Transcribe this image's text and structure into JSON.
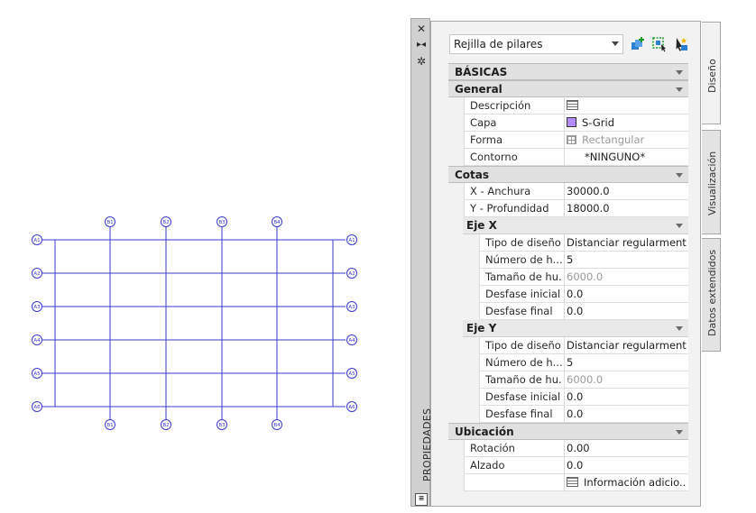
{
  "drawing": {
    "line_color": "#3a3ad0",
    "rows_left": [
      "A1",
      "A2",
      "A3",
      "A4",
      "A5",
      "A6"
    ],
    "rows_right": [
      "A1",
      "A2",
      "A3",
      "A4",
      "A5",
      "A6"
    ],
    "cols_top": [
      "B1",
      "B2",
      "B3",
      "B4"
    ],
    "cols_bottom": [
      "B1",
      "B2",
      "B3",
      "B4"
    ]
  },
  "palette": {
    "title": "PROPIEDADES",
    "style_select": {
      "value": "Rejilla de pilares"
    },
    "tabs": [
      "Diseño",
      "Visualización",
      "Datos extendidos"
    ],
    "basicas": "BÁSICAS",
    "general": {
      "title": "General",
      "rows": [
        {
          "name": "Descripción",
          "value": "",
          "icon": "description-icon"
        },
        {
          "name": "Capa",
          "value": "S-Grid",
          "icon": "layer-swatch",
          "swatch_color": "#b58cff"
        },
        {
          "name": "Forma",
          "value": "Rectangular",
          "icon": "grid-shape-icon",
          "disabled": true
        },
        {
          "name": "Contorno",
          "value": "*NINGUNO*"
        }
      ]
    },
    "cotas": {
      "title": "Cotas",
      "rows": [
        {
          "name": "X - Anchura",
          "value": "30000.0"
        },
        {
          "name": "Y - Profundidad",
          "value": "18000.0"
        }
      ],
      "eje_x": {
        "title": "Eje X",
        "rows": [
          {
            "name": "Tipo de diseño",
            "value": "Distanciar regularmente"
          },
          {
            "name": "Número de h...",
            "value": "5"
          },
          {
            "name": "Tamaño de hu...",
            "value": "6000.0",
            "disabled": true
          },
          {
            "name": "Desfase inicial",
            "value": "0.0"
          },
          {
            "name": "Desfase final",
            "value": "0.0"
          }
        ]
      },
      "eje_y": {
        "title": "Eje Y",
        "rows": [
          {
            "name": "Tipo de diseño",
            "value": "Distanciar regularmente"
          },
          {
            "name": "Número de h...",
            "value": "5"
          },
          {
            "name": "Tamaño de hu...",
            "value": "6000.0",
            "disabled": true
          },
          {
            "name": "Desfase inicial",
            "value": "0.0"
          },
          {
            "name": "Desfase final",
            "value": "0.0"
          }
        ]
      }
    },
    "ubicacion": {
      "title": "Ubicación",
      "rows": [
        {
          "name": "Rotación",
          "value": "0.00"
        },
        {
          "name": "Alzado",
          "value": "0.0"
        },
        {
          "name": "",
          "value": "Información adicio...",
          "icon": "info-icon"
        }
      ]
    }
  }
}
